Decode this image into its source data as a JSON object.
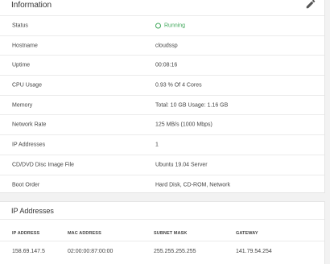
{
  "info": {
    "title": "Information",
    "rows": [
      {
        "label": "Status",
        "value": "Running"
      },
      {
        "label": "Hostname",
        "value": "cloudssp"
      },
      {
        "label": "Uptime",
        "value": "00:08:16"
      },
      {
        "label": "CPU Usage",
        "value": "0.93 % Of 4 Cores"
      },
      {
        "label": "Memory",
        "value": "Total: 10 GB Usage: 1.16 GB"
      },
      {
        "label": "Network Rate",
        "value": "125 MB/s (1000 Mbps)"
      },
      {
        "label": "IP Addresses",
        "value": "1"
      },
      {
        "label": "CD/DVD Disc Image File",
        "value": "Ubuntu 19.04 Server"
      },
      {
        "label": "Boot Order",
        "value": "Hard Disk, CD-ROM, Network"
      }
    ],
    "edit_icon": "pencil-icon",
    "status_color": "#3fa75a"
  },
  "ip_addresses": {
    "title": "IP Addresses",
    "columns": [
      "IP ADDRESS",
      "MAC ADDRESS",
      "SUBNET MASK",
      "GATEWAY"
    ],
    "rows": [
      [
        "158.69.147.5",
        "02:00:00:87:00:00",
        "255.255.255.255",
        "141.79.54.254"
      ]
    ]
  }
}
